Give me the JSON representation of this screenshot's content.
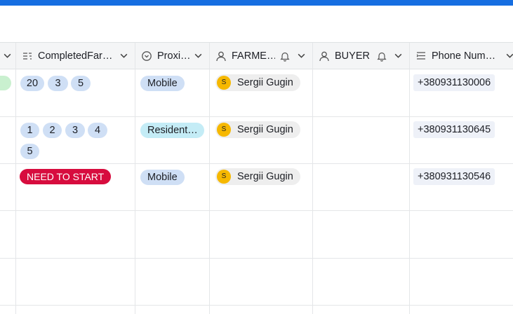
{
  "columns": [
    {
      "label": "",
      "icon": "chevron-down-icon"
    },
    {
      "label": "CompletedFar…",
      "icon": "multiple-select-icon"
    },
    {
      "label": "Proxi…",
      "icon": "single-select-icon"
    },
    {
      "label": "FARME…",
      "icon": "user-icon"
    },
    {
      "label": "BUYER",
      "icon": "user-icon"
    },
    {
      "label": "Phone Num…",
      "icon": "phone-field-icon"
    }
  ],
  "rows": [
    {
      "completed": [
        "20",
        "3",
        "5"
      ],
      "proximity": "Mobile",
      "farmer": {
        "initial": "S",
        "name": "Sergii Gugin"
      },
      "phone": "+380931130006"
    },
    {
      "completed": [
        "1",
        "2",
        "3",
        "4",
        "5"
      ],
      "proximity": "Resident…",
      "farmer": {
        "initial": "S",
        "name": "Sergii Gugin"
      },
      "phone": "+380931130645"
    },
    {
      "completed": [
        "NEED TO START"
      ],
      "proximity": "Mobile",
      "farmer": {
        "initial": "S",
        "name": "Sergii Gugin"
      },
      "phone": "+380931130546"
    }
  ],
  "colors": {
    "accent": "#166ee1",
    "number_pill": "#cfdff5",
    "resident_pill": "#c4ecf6",
    "need_to_start": "#d70c3e",
    "avatar": "#f6b800"
  }
}
